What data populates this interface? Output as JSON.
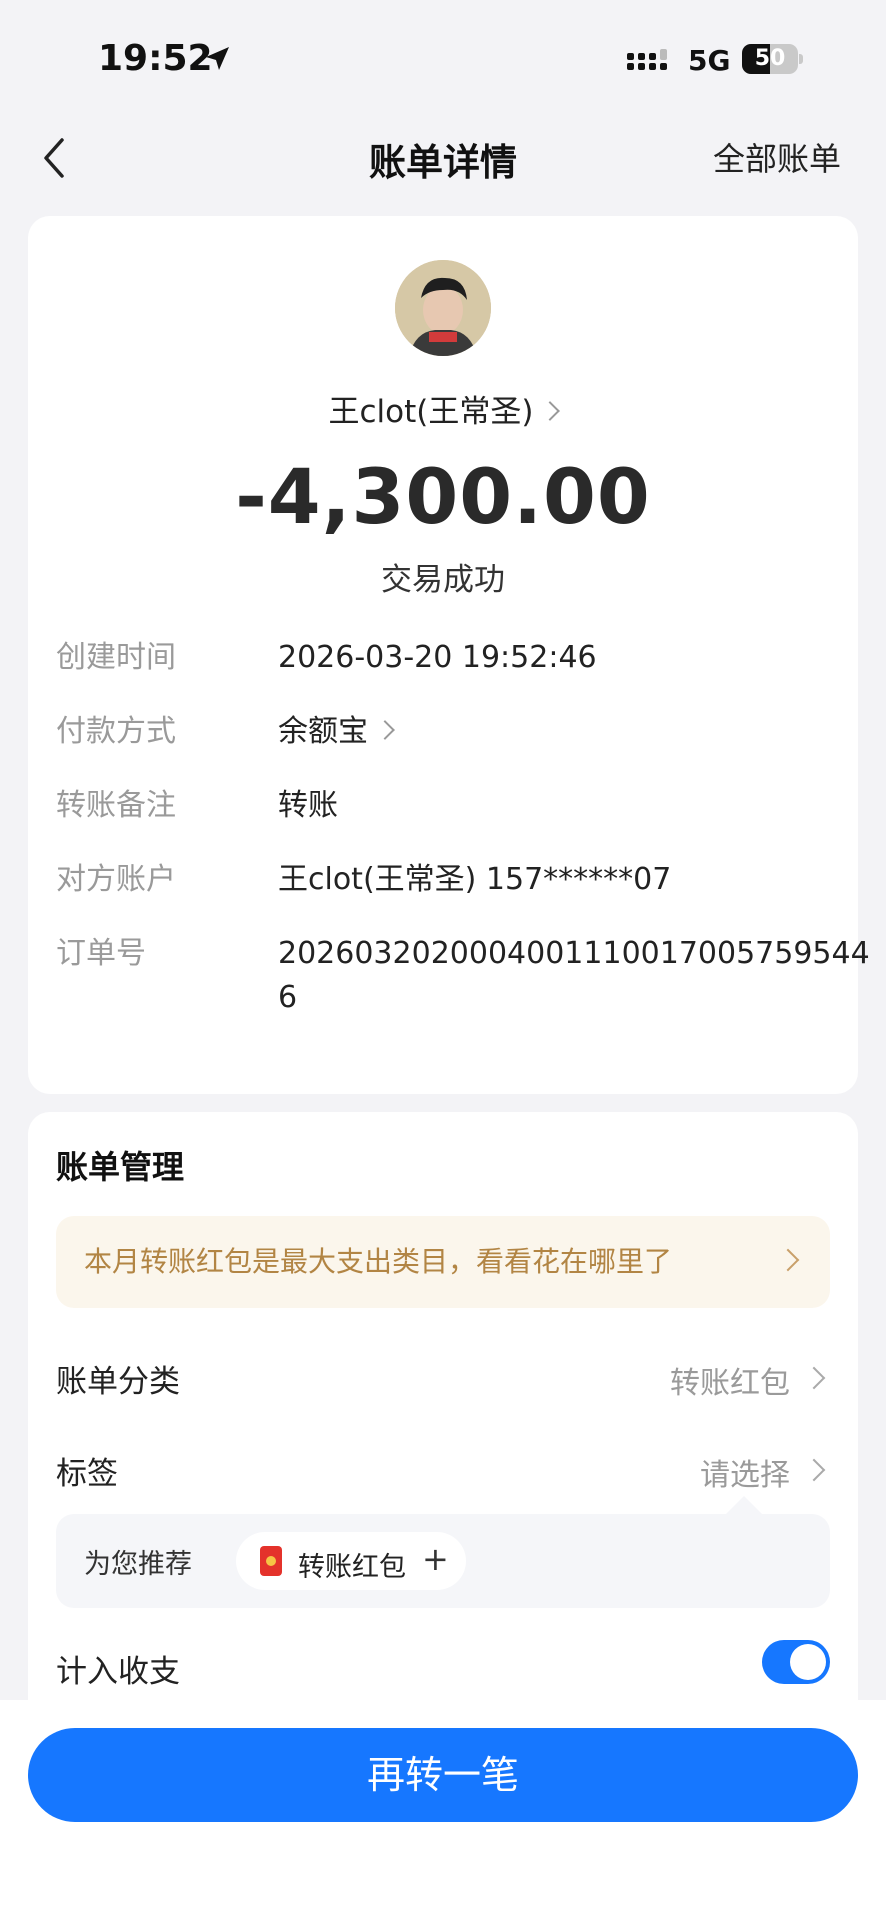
{
  "status_bar": {
    "time": "19:52",
    "network": "5G",
    "battery_percent": 50,
    "battery_label": "50",
    "icons": [
      "location-arrow-icon",
      "signal-icon",
      "battery-icon"
    ]
  },
  "nav": {
    "title": "账单详情",
    "right_link": "全部账单",
    "back_icon": "chevron-left-icon"
  },
  "transaction": {
    "payee": "王clot(王常圣)",
    "amount": "-4,300.00",
    "status": "交易成功",
    "details": [
      {
        "label": "创建时间",
        "value": "2026-03-20 19:52:46"
      },
      {
        "label": "付款方式",
        "value": "余额宝"
      },
      {
        "label": "转账备注",
        "value": "转账"
      },
      {
        "label": "对方账户",
        "value": "王clot(王常圣) 157******07"
      },
      {
        "label": "订单号",
        "value": "20260320200040011100170057595446"
      }
    ]
  },
  "manage": {
    "title": "账单管理",
    "promo": "本月转账红包是最大支出类目，看看花在哪里了",
    "category_label": "账单分类",
    "category_value": "转账红包",
    "tag_label": "标签",
    "tag_value": "请选择",
    "suggest_label": "为您推荐",
    "suggest_tag": "转账红包",
    "suggest_plus": "+",
    "include_label": "计入收支",
    "include_enabled": true
  },
  "bottom": {
    "button_label": "再转一笔"
  },
  "colors": {
    "primary": "#1677ff",
    "promo_text": "#b28544",
    "background": "#f3f3f6"
  }
}
